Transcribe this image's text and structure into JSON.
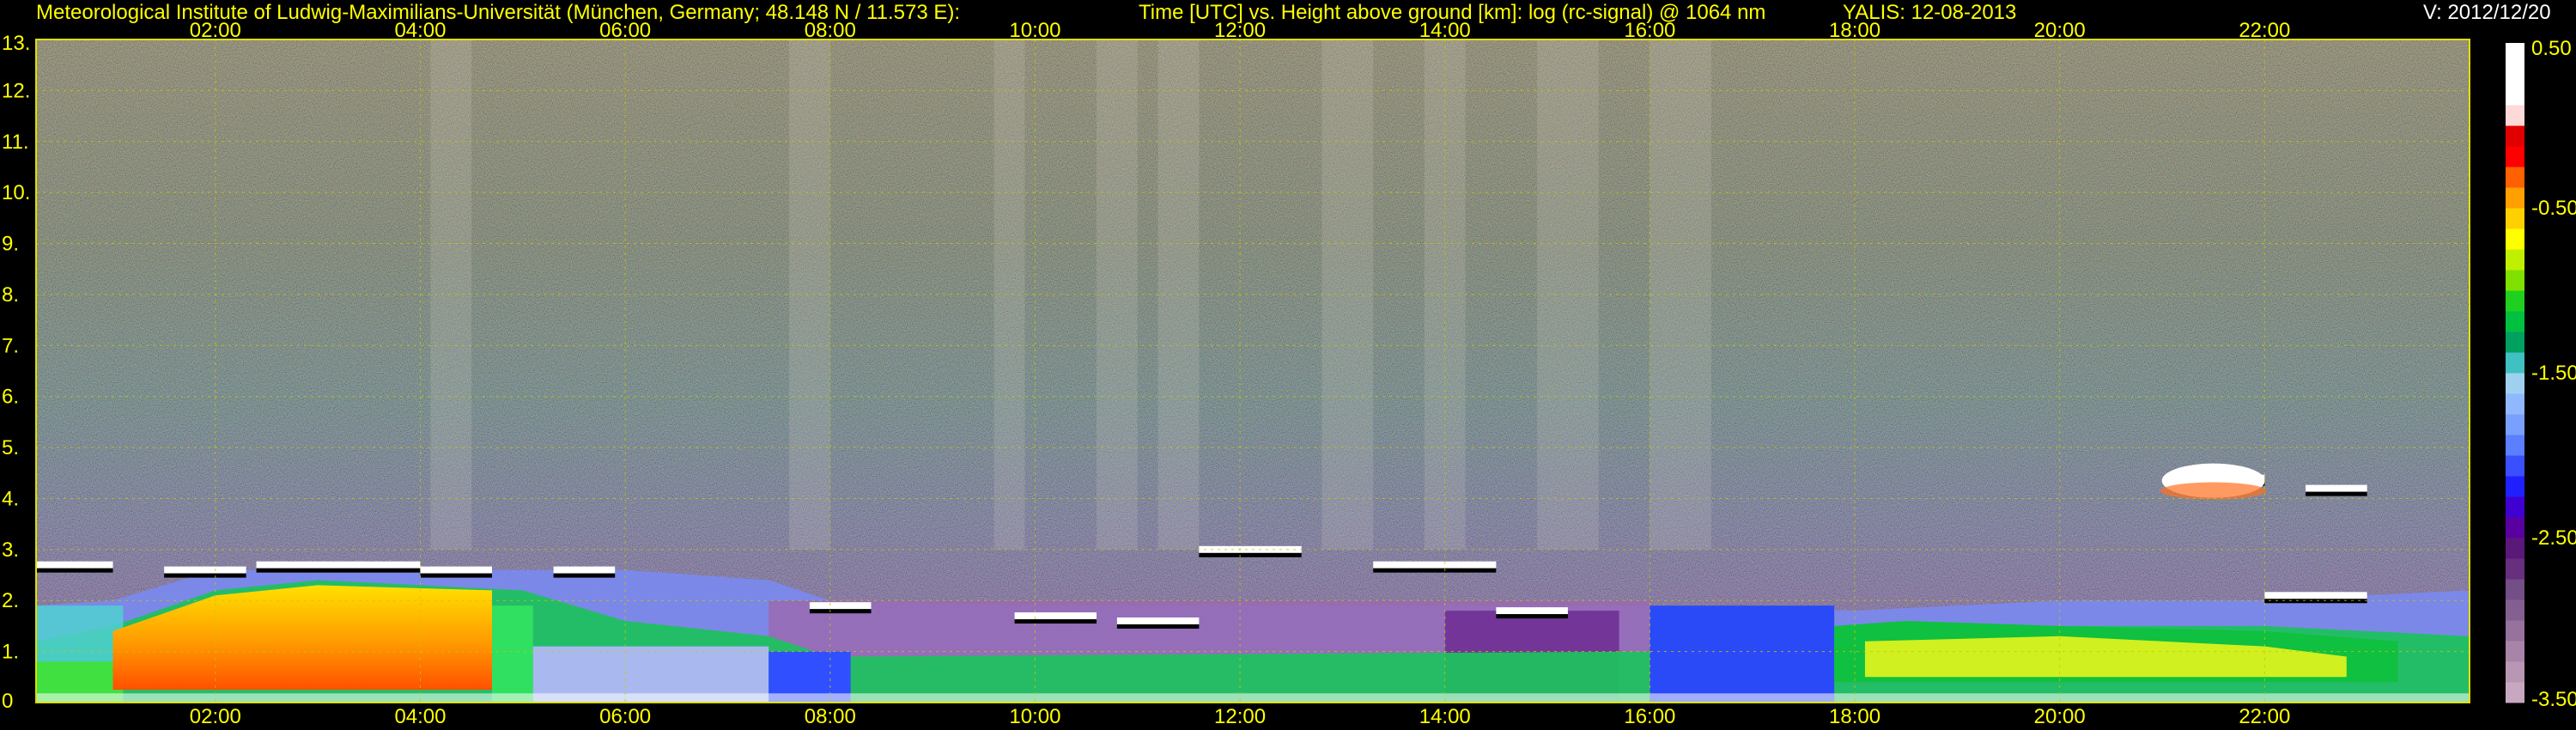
{
  "header": {
    "institute": "Meteorological Institute of Ludwig-Maximilians-Universität (München, Germany; 48.148 N / 11.573 E):",
    "description": "Time [UTC] vs. Height above ground [km]: log (rc-signal) @ 1064 nm",
    "instrument_date": "YALIS: 12-08-2013",
    "version": "V: 2012/12/20"
  },
  "chart_data": {
    "type": "heatmap",
    "title": "Time [UTC] vs. Height above ground [km]: log (rc-signal) @ 1064 nm",
    "x_ticks": [
      "02:00",
      "04:00",
      "06:00",
      "08:00",
      "10:00",
      "12:00",
      "14:00",
      "16:00",
      "18:00",
      "20:00",
      "22:00"
    ],
    "x_tick_hours": [
      2,
      4,
      6,
      8,
      10,
      12,
      14,
      16,
      18,
      20,
      22
    ],
    "xlim": [
      0.25,
      24
    ],
    "y_ticks": [
      "0",
      "1.",
      "2.",
      "3.",
      "4.",
      "5.",
      "6.",
      "7.",
      "8.",
      "9.",
      "10.",
      "11.",
      "12.",
      "13."
    ],
    "y_tick_values": [
      0,
      1,
      2,
      3,
      4,
      5,
      6,
      7,
      8,
      9,
      10,
      11,
      12,
      13
    ],
    "ylim": [
      0,
      13
    ],
    "grid": true,
    "colorbar": {
      "ticks": [
        "0.50",
        "-0.50",
        "-1.50",
        "-2.50",
        "-3.50"
      ],
      "tick_values": [
        0.5,
        -0.5,
        -1.5,
        -2.5,
        -3.5
      ],
      "range": [
        -3.5,
        0.5
      ],
      "colors": [
        "#c8a8c0",
        "#b896b4",
        "#a884a8",
        "#96729c",
        "#846090",
        "#744e86",
        "#66307e",
        "#5a1878",
        "#5a00a0",
        "#4000d0",
        "#2020ff",
        "#3a50ff",
        "#5a80ff",
        "#7aa0ff",
        "#90b8ff",
        "#a0d0f0",
        "#40c0c0",
        "#00a060",
        "#00c040",
        "#20d020",
        "#80e000",
        "#c0f000",
        "#ffff00",
        "#ffd000",
        "#ffa000",
        "#ff6000",
        "#ff0000",
        "#e00000",
        "#ffd8d8",
        "#ffffff",
        "#ffffff",
        "#ffffff"
      ]
    },
    "layers": {
      "aerosol_layer_top_km": [
        {
          "hour": 0.25,
          "km": 1.9
        },
        {
          "hour": 1,
          "km": 2.0
        },
        {
          "hour": 2,
          "km": 2.6
        },
        {
          "hour": 3,
          "km": 2.6
        },
        {
          "hour": 4,
          "km": 2.6
        },
        {
          "hour": 5,
          "km": 2.6
        },
        {
          "hour": 6,
          "km": 2.6
        },
        {
          "hour": 7.4,
          "km": 2.4
        },
        {
          "hour": 8,
          "km": 2.0
        },
        {
          "hour": 10,
          "km": 1.9
        },
        {
          "hour": 12,
          "km": 1.9
        },
        {
          "hour": 14,
          "km": 1.9
        },
        {
          "hour": 16,
          "km": 1.9
        },
        {
          "hour": 18,
          "km": 1.8
        },
        {
          "hour": 20,
          "km": 2.0
        },
        {
          "hour": 22,
          "km": 2.0
        },
        {
          "hour": 24,
          "km": 2.2
        }
      ],
      "dense_layer_top_km": [
        {
          "hour": 0.25,
          "km": 1.2
        },
        {
          "hour": 1,
          "km": 1.5
        },
        {
          "hour": 2,
          "km": 2.2
        },
        {
          "hour": 3,
          "km": 2.4
        },
        {
          "hour": 4,
          "km": 2.3
        },
        {
          "hour": 5,
          "km": 2.2
        },
        {
          "hour": 6,
          "km": 1.6
        },
        {
          "hour": 7.4,
          "km": 1.3
        },
        {
          "hour": 8,
          "km": 0.9
        },
        {
          "hour": 16,
          "km": 1.0
        },
        {
          "hour": 18,
          "km": 1.4
        },
        {
          "hour": 20,
          "km": 1.5
        },
        {
          "hour": 22,
          "km": 1.5
        },
        {
          "hour": 24,
          "km": 1.3
        }
      ],
      "cloud_patches": [
        {
          "start": 0.25,
          "end": 1.0,
          "km": 2.7
        },
        {
          "start": 1.5,
          "end": 2.3,
          "km": 2.6
        },
        {
          "start": 2.4,
          "end": 4.0,
          "km": 2.7
        },
        {
          "start": 4.0,
          "end": 4.7,
          "km": 2.6
        },
        {
          "start": 5.3,
          "end": 5.9,
          "km": 2.6
        },
        {
          "start": 7.8,
          "end": 8.4,
          "km": 1.9
        },
        {
          "start": 9.8,
          "end": 10.6,
          "km": 1.7
        },
        {
          "start": 10.8,
          "end": 11.6,
          "km": 1.6
        },
        {
          "start": 11.6,
          "end": 12.6,
          "km": 3.0
        },
        {
          "start": 13.3,
          "end": 14.5,
          "km": 2.7
        },
        {
          "start": 14.5,
          "end": 15.2,
          "km": 1.8
        },
        {
          "start": 21.1,
          "end": 22.0,
          "km": 4.4
        },
        {
          "start": 22.4,
          "end": 23.0,
          "km": 4.2
        },
        {
          "start": 22.0,
          "end": 23.0,
          "km": 2.1
        }
      ],
      "bright_streaks": [
        {
          "start": 9.6,
          "end": 9.9
        },
        {
          "start": 10.6,
          "end": 11.0
        },
        {
          "start": 11.2,
          "end": 11.6
        },
        {
          "start": 12.8,
          "end": 13.3
        },
        {
          "start": 13.8,
          "end": 14.2
        },
        {
          "start": 14.9,
          "end": 15.5
        },
        {
          "start": 4.1,
          "end": 4.5
        },
        {
          "start": 7.6,
          "end": 8.0
        },
        {
          "start": 16.0,
          "end": 16.6
        }
      ]
    }
  }
}
